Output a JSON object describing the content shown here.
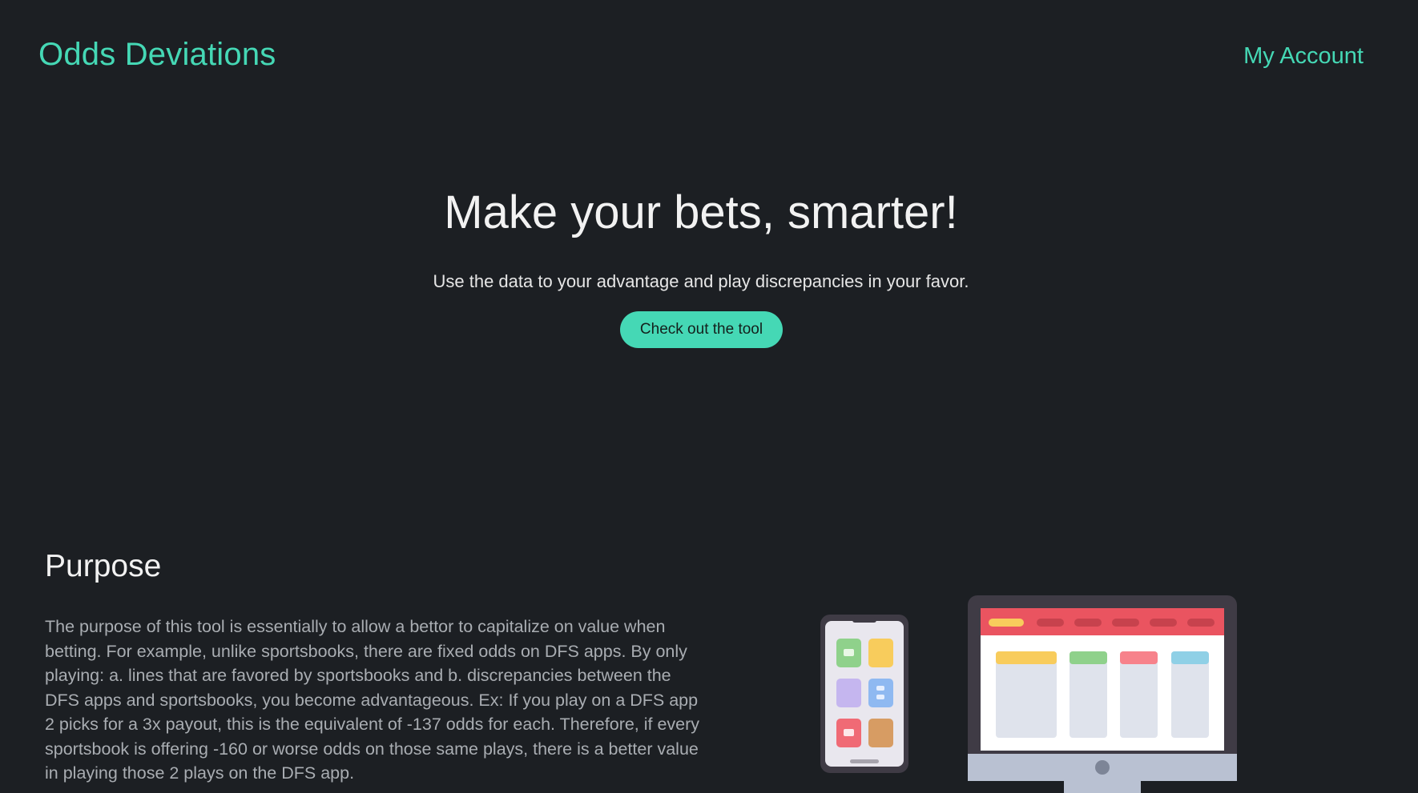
{
  "header": {
    "brand": "Odds Deviations",
    "account_link": "My Account"
  },
  "hero": {
    "title": "Make your bets, smarter!",
    "subtitle": "Use the data to your advantage and play discrepancies in your favor.",
    "cta_label": "Check out the tool"
  },
  "purpose": {
    "title": "Purpose",
    "body": "The purpose of this tool is essentially to allow a bettor to capitalize on value when betting. For example, unlike sportsbooks, there are fixed odds on DFS apps. By only playing: a. lines that are favored by sportsbooks and b. discrepancies between the DFS apps and sportsbooks, you become advantageous. Ex: If you play on a DFS app 2 picks for a 3x payout, this is the equivalent of -137 odds for each. Therefore, if every sportsbook is offering -160 or worse odds on those same plays, there is a better value in playing those 2 plays on the DFS app."
  },
  "illustration": {
    "phone_icon": "smartphone-app-grid-icon",
    "monitor_icon": "desktop-dashboard-icon"
  },
  "colors": {
    "background": "#1c1f23",
    "accent": "#45d8b5"
  }
}
